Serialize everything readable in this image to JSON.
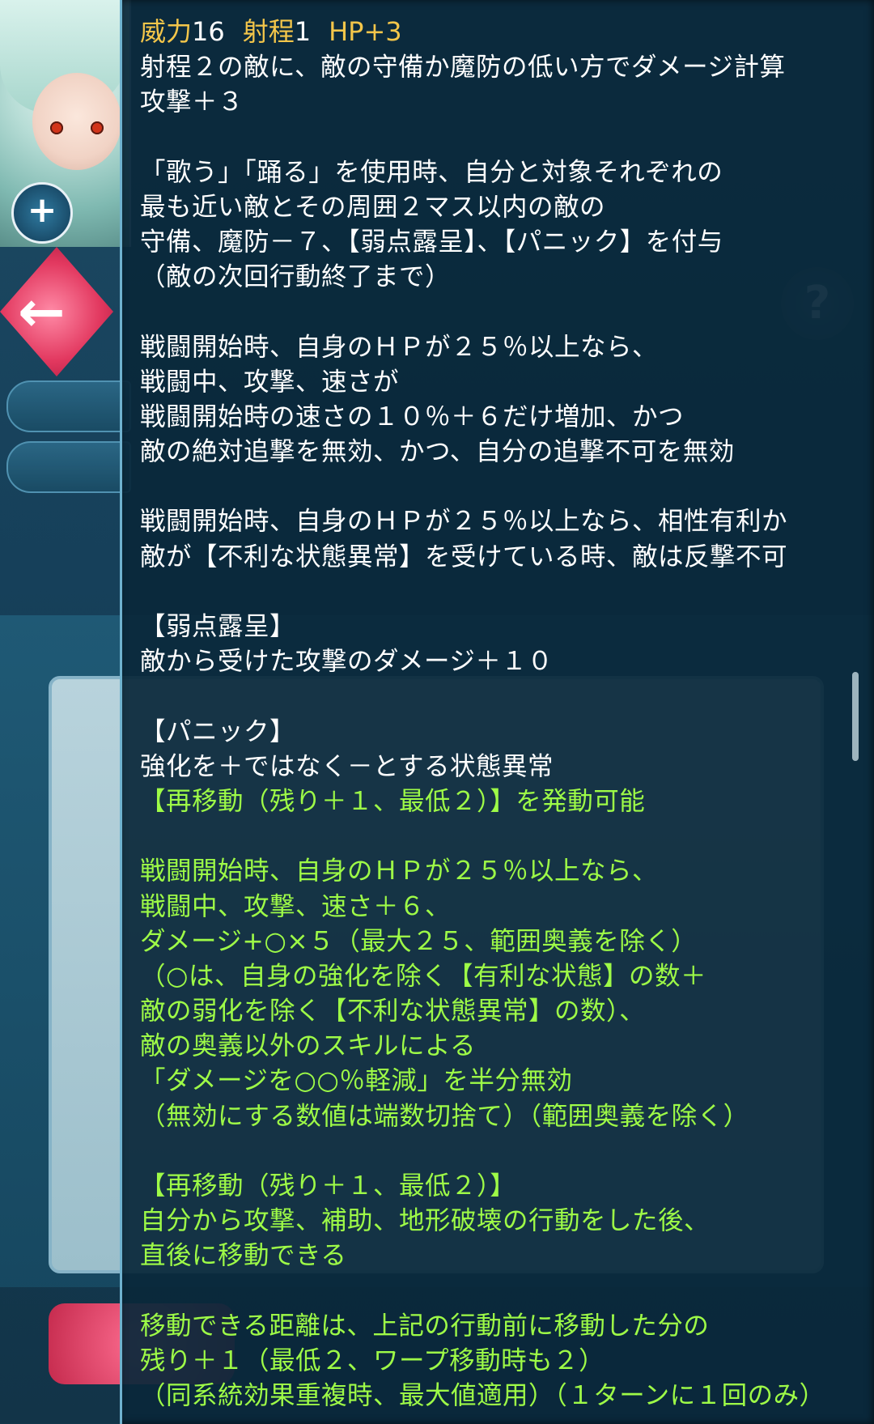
{
  "background": {
    "plus_button_symbol": "+",
    "back_arrow_symbol": "←",
    "help_symbol": "?"
  },
  "tooltip": {
    "stats": {
      "might_label": "威力",
      "might_value": "16",
      "range_label": "射程",
      "range_value": "1",
      "hp_bonus": "HP+3"
    },
    "lines": [
      {
        "text": "射程２の敵に、敵の守備か魔防の低い方でダメージ計算",
        "color": "white"
      },
      {
        "text": "攻撃＋３",
        "color": "white"
      },
      {
        "text": "",
        "color": "blank"
      },
      {
        "text": "「歌う」「踊る」を使用時、自分と対象それぞれの",
        "color": "white"
      },
      {
        "text": "最も近い敵とその周囲２マス以内の敵の",
        "color": "white"
      },
      {
        "text": "守備、魔防－７、【弱点露呈】、【パニック】を付与",
        "color": "white"
      },
      {
        "text": "（敵の次回行動終了まで）",
        "color": "white"
      },
      {
        "text": "",
        "color": "blank"
      },
      {
        "text": "戦闘開始時、自身のＨＰが２５％以上なら、",
        "color": "white"
      },
      {
        "text": "戦闘中、攻撃、速さが",
        "color": "white"
      },
      {
        "text": "戦闘開始時の速さの１０％＋６だけ増加、かつ",
        "color": "white"
      },
      {
        "text": "敵の絶対追撃を無効、かつ、自分の追撃不可を無効",
        "color": "white"
      },
      {
        "text": "",
        "color": "blank"
      },
      {
        "text": "戦闘開始時、自身のＨＰが２５％以上なら、相性有利か",
        "color": "white"
      },
      {
        "text": "敵が【不利な状態異常】を受けている時、敵は反撃不可",
        "color": "white"
      },
      {
        "text": "",
        "color": "blank"
      },
      {
        "text": "【弱点露呈】",
        "color": "white"
      },
      {
        "text": "敵から受けた攻撃のダメージ＋１０",
        "color": "white"
      },
      {
        "text": "",
        "color": "blank"
      },
      {
        "text": "【パニック】",
        "color": "white"
      },
      {
        "text": "強化を＋ではなく－とする状態異常",
        "color": "white"
      },
      {
        "text": "【再移動（残り＋１、最低２）】を発動可能",
        "color": "green"
      },
      {
        "text": "",
        "color": "blank"
      },
      {
        "text": "戦闘開始時、自身のＨＰが２５％以上なら、",
        "color": "green"
      },
      {
        "text": "戦闘中、攻撃、速さ＋６、",
        "color": "green"
      },
      {
        "text": "ダメージ+○×５（最大２５、範囲奥義を除く）",
        "color": "green"
      },
      {
        "text": "（○は、自身の強化を除く【有利な状態】の数＋",
        "color": "green"
      },
      {
        "text": "敵の弱化を除く【不利な状態異常】の数）、",
        "color": "green"
      },
      {
        "text": "敵の奥義以外のスキルによる",
        "color": "green"
      },
      {
        "text": "「ダメージを○○％軽減」を半分無効",
        "color": "green"
      },
      {
        "text": "（無効にする数値は端数切捨て）（範囲奥義を除く）",
        "color": "green"
      },
      {
        "text": "",
        "color": "blank"
      },
      {
        "text": "【再移動（残り＋１、最低２）】",
        "color": "green"
      },
      {
        "text": "自分から攻撃、補助、地形破壊の行動をした後、",
        "color": "green"
      },
      {
        "text": "直後に移動できる",
        "color": "green"
      },
      {
        "text": "",
        "color": "blank"
      },
      {
        "text": "移動できる距離は、上記の行動前に移動した分の",
        "color": "green"
      },
      {
        "text": "残り＋１（最低２、ワープ移動時も２）",
        "color": "green"
      },
      {
        "text": "（同系統効果重複時、最大値適用）（１ターンに１回のみ）",
        "color": "green"
      }
    ]
  }
}
